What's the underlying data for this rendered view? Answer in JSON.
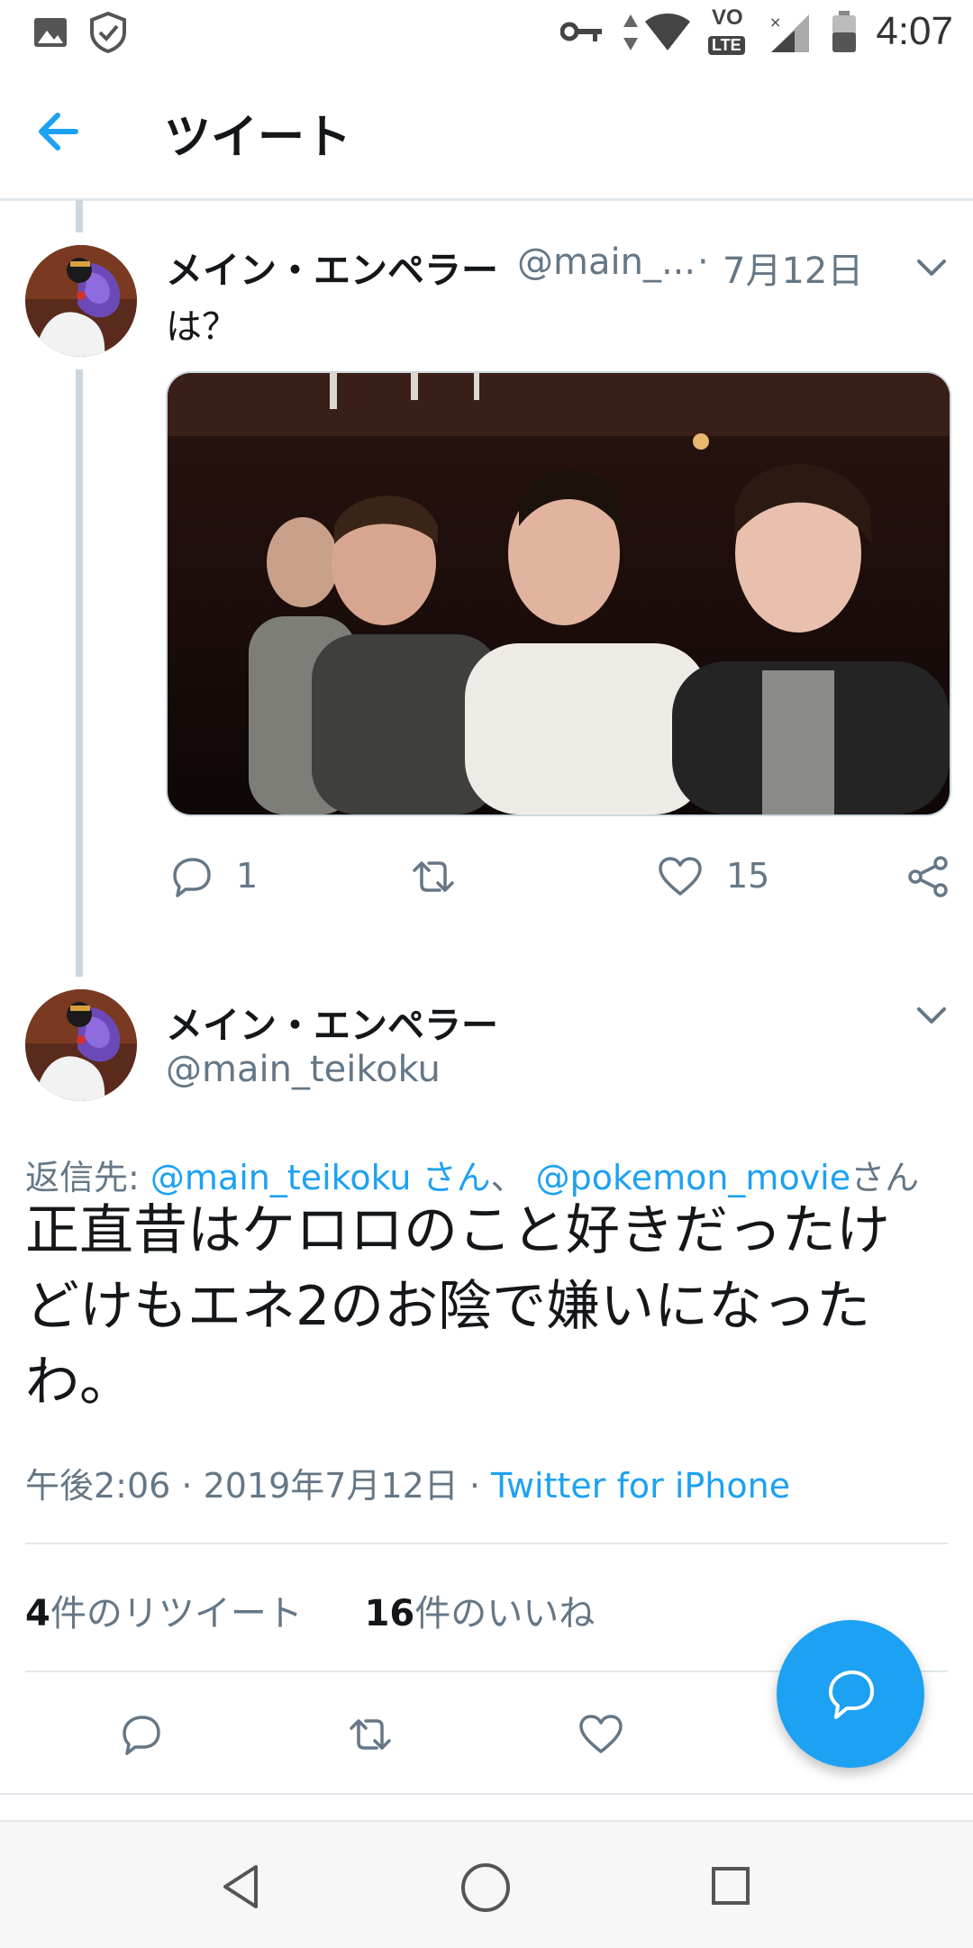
{
  "status_bar": {
    "time": "4:07",
    "left_icons": [
      "image-icon",
      "shield-check-icon"
    ],
    "right_icons": [
      "key-icon",
      "data-arrows-icon",
      "wifi-icon",
      "volte-icon",
      "signal-icon",
      "battery-icon"
    ],
    "volte_label": "VO",
    "lte_label": "LTE"
  },
  "header": {
    "title": "ツイート",
    "back_icon": "back-arrow-icon"
  },
  "tweet1": {
    "name": "メイン・エンペラー",
    "handle": "@main_...",
    "separator": "·",
    "date": "7月12日",
    "text": "は？",
    "actions": {
      "reply_count": "1",
      "retweet_count": "",
      "like_count": "15"
    }
  },
  "tweet2": {
    "name": "メイン・エンペラー",
    "handle": "@main_teikoku",
    "reply_to": {
      "prefix": "返信先: ",
      "user1": "@main_teikoku さん",
      "sep": "、 ",
      "user2": "@pokemon_movie",
      "suffix": "さん"
    },
    "text": "正直昔はケロロのこと好きだったけどけもエネ2のお陰で嫌いになったわ。",
    "meta": {
      "time_date": "午後2:06 · 2019年7月12日 · ",
      "source": "Twitter for iPhone"
    },
    "stats": {
      "retweets": "4",
      "retweets_label": "件のリツイート",
      "likes": "16",
      "likes_label": "件のいいね"
    }
  },
  "colors": {
    "accent": "#1da1f2",
    "text": "#14171a",
    "secondary": "#657786",
    "divider": "#e1e8ed"
  }
}
